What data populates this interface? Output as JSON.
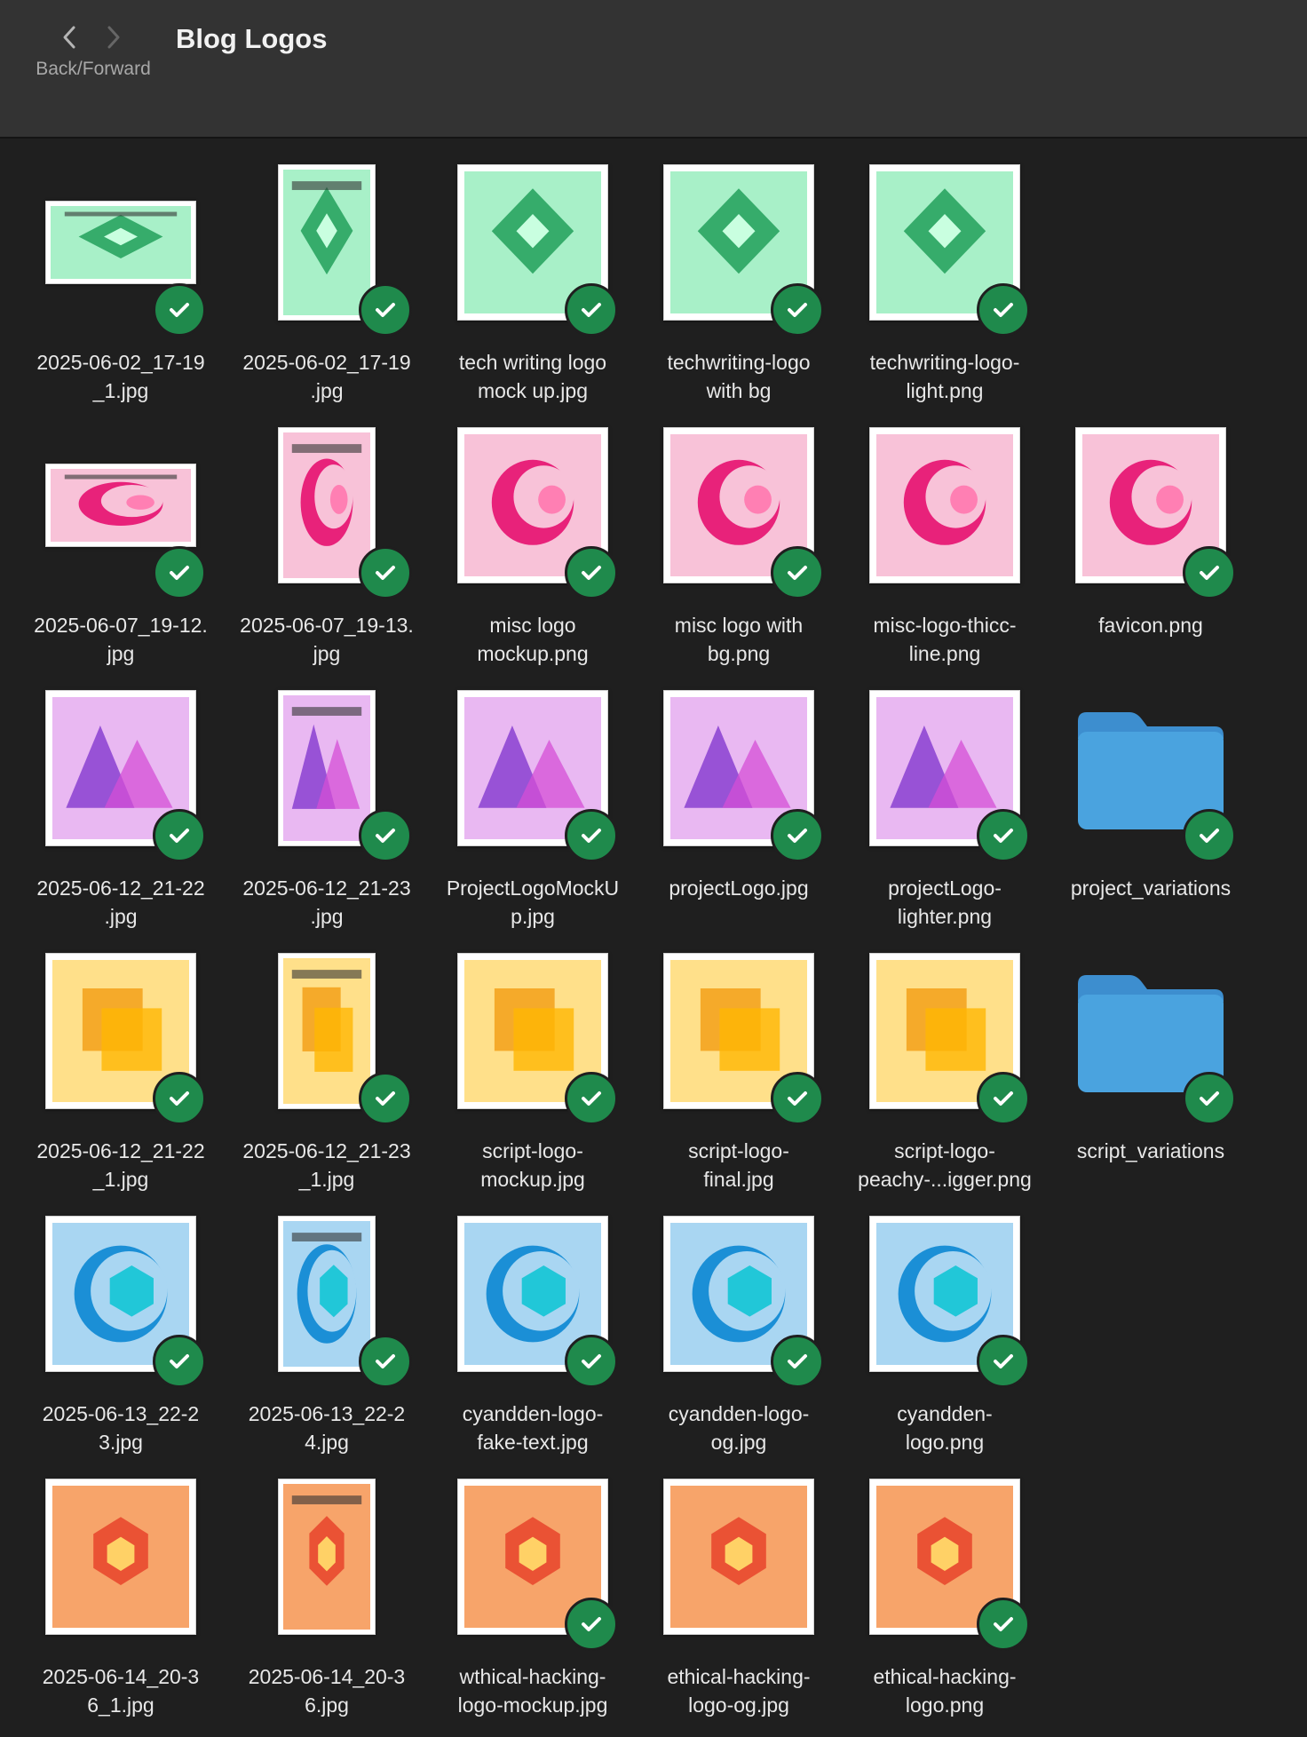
{
  "window": {
    "title": "Blog Logos",
    "nav_label": "Back/Forward"
  },
  "colors": {
    "green": "#22a05b",
    "pink": "#e8227a",
    "purple": "#8a3fd1",
    "orange": "#f39c12",
    "cyan": "#21c7d8",
    "red": "#e8442a",
    "folder": "#4aa3df",
    "check": "#1f8a4c"
  },
  "rows": [
    [
      {
        "name": "2025-06-02_17-19\n_1.jpg",
        "kind": "wide",
        "theme": "green",
        "checked": true
      },
      {
        "name": "2025-06-02_17-19\n.jpg",
        "kind": "tall",
        "theme": "green",
        "checked": true
      },
      {
        "name": "tech writing logo\nmock up.jpg",
        "kind": "square",
        "theme": "green",
        "checked": true
      },
      {
        "name": "techwriting-logo\nwith bg",
        "kind": "square",
        "theme": "green",
        "checked": true
      },
      {
        "name": "techwriting-logo-\nlight.png",
        "kind": "square",
        "theme": "green",
        "checked": true
      }
    ],
    [
      {
        "name": "2025-06-07_19-12.\njpg",
        "kind": "wide",
        "theme": "pink",
        "checked": true
      },
      {
        "name": "2025-06-07_19-13.\njpg",
        "kind": "tall",
        "theme": "pink",
        "checked": true
      },
      {
        "name": "misc logo\nmockup.png",
        "kind": "square",
        "theme": "pink",
        "checked": true
      },
      {
        "name": "misc logo with\nbg.png",
        "kind": "square",
        "theme": "pink",
        "checked": true
      },
      {
        "name": "misc-logo-thicc-\nline.png",
        "kind": "square",
        "theme": "pink",
        "checked": false
      },
      {
        "name": "favicon.png",
        "kind": "square",
        "theme": "pink",
        "checked": true
      }
    ],
    [
      {
        "name": "2025-06-12_21-22\n.jpg",
        "kind": "square",
        "theme": "purple",
        "checked": true
      },
      {
        "name": "2025-06-12_21-23\n.jpg",
        "kind": "tall",
        "theme": "purple",
        "checked": true
      },
      {
        "name": "ProjectLogoMockU\np.jpg",
        "kind": "square",
        "theme": "purple",
        "checked": true
      },
      {
        "name": "projectLogo.jpg",
        "kind": "square",
        "theme": "purple",
        "checked": true
      },
      {
        "name": "projectLogo-\nlighter.png",
        "kind": "square",
        "theme": "purple",
        "checked": true
      },
      {
        "name": "project_variations",
        "kind": "folder",
        "theme": "folder",
        "checked": true
      }
    ],
    [
      {
        "name": "2025-06-12_21-22\n_1.jpg",
        "kind": "square",
        "theme": "orange",
        "checked": true
      },
      {
        "name": "2025-06-12_21-23\n_1.jpg",
        "kind": "tall",
        "theme": "orange",
        "checked": true
      },
      {
        "name": "script-logo-\nmockup.jpg",
        "kind": "square",
        "theme": "orange",
        "checked": true
      },
      {
        "name": "script-logo-\nfinal.jpg",
        "kind": "square",
        "theme": "orange",
        "checked": true
      },
      {
        "name": "script-logo-\npeachy-...igger.png",
        "kind": "square",
        "theme": "orange",
        "checked": true
      },
      {
        "name": "script_variations",
        "kind": "folder",
        "theme": "folder",
        "checked": true
      }
    ],
    [
      {
        "name": "2025-06-13_22-2\n3.jpg",
        "kind": "square",
        "theme": "cyan",
        "checked": true
      },
      {
        "name": "2025-06-13_22-2\n4.jpg",
        "kind": "tall",
        "theme": "cyan",
        "checked": true
      },
      {
        "name": "cyandden-logo-\nfake-text.jpg",
        "kind": "square",
        "theme": "cyan",
        "checked": true
      },
      {
        "name": "cyandden-logo-\nog.jpg",
        "kind": "square",
        "theme": "cyan",
        "checked": true
      },
      {
        "name": "cyandden-\nlogo.png",
        "kind": "square",
        "theme": "cyan",
        "checked": true
      }
    ],
    [
      {
        "name": "2025-06-14_20-3\n6_1.jpg",
        "kind": "square",
        "theme": "red",
        "checked": false
      },
      {
        "name": "2025-06-14_20-3\n6.jpg",
        "kind": "tall",
        "theme": "red",
        "checked": false
      },
      {
        "name": "wthical-hacking-\nlogo-mockup.jpg",
        "kind": "square",
        "theme": "red",
        "checked": true
      },
      {
        "name": "ethical-hacking-\nlogo-og.jpg",
        "kind": "square",
        "theme": "red",
        "checked": false
      },
      {
        "name": "ethical-hacking-\nlogo.png",
        "kind": "square",
        "theme": "red",
        "checked": true
      }
    ]
  ]
}
